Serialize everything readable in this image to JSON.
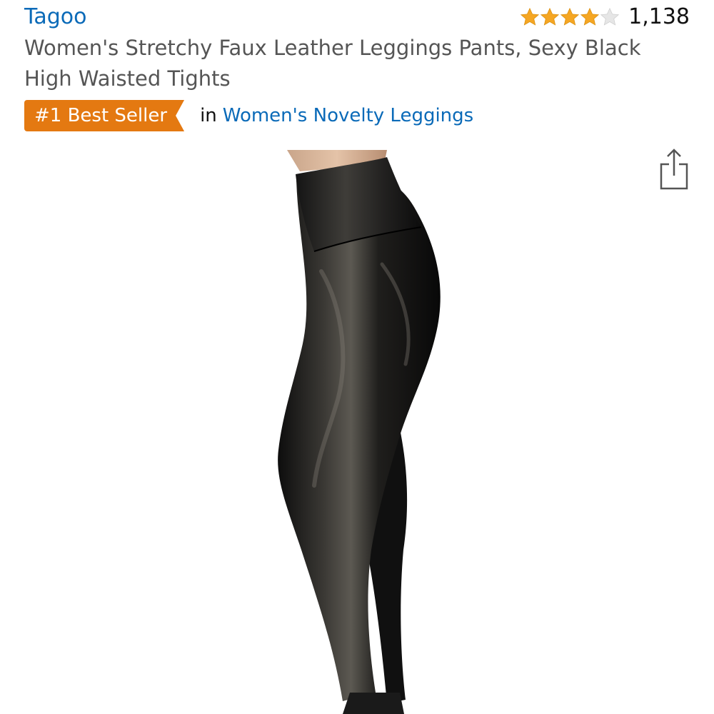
{
  "product": {
    "brand": "Tagoo",
    "title": "Women's Stretchy Faux Leather Leggings Pants, Sexy Black High Waisted Tights",
    "rating": {
      "stars": 4,
      "out_of": 5,
      "review_count": "1,138"
    },
    "badge": {
      "label": "#1 Best Seller",
      "in_text": "in",
      "category": "Women's Novelty Leggings"
    }
  },
  "icons": {
    "share": "share-icon",
    "star": "star-icon"
  },
  "colors": {
    "link": "#0a6ab8",
    "badge": "#e47911",
    "star_filled": "#f5a623",
    "star_empty": "#dddddd",
    "title_text": "#555555"
  }
}
